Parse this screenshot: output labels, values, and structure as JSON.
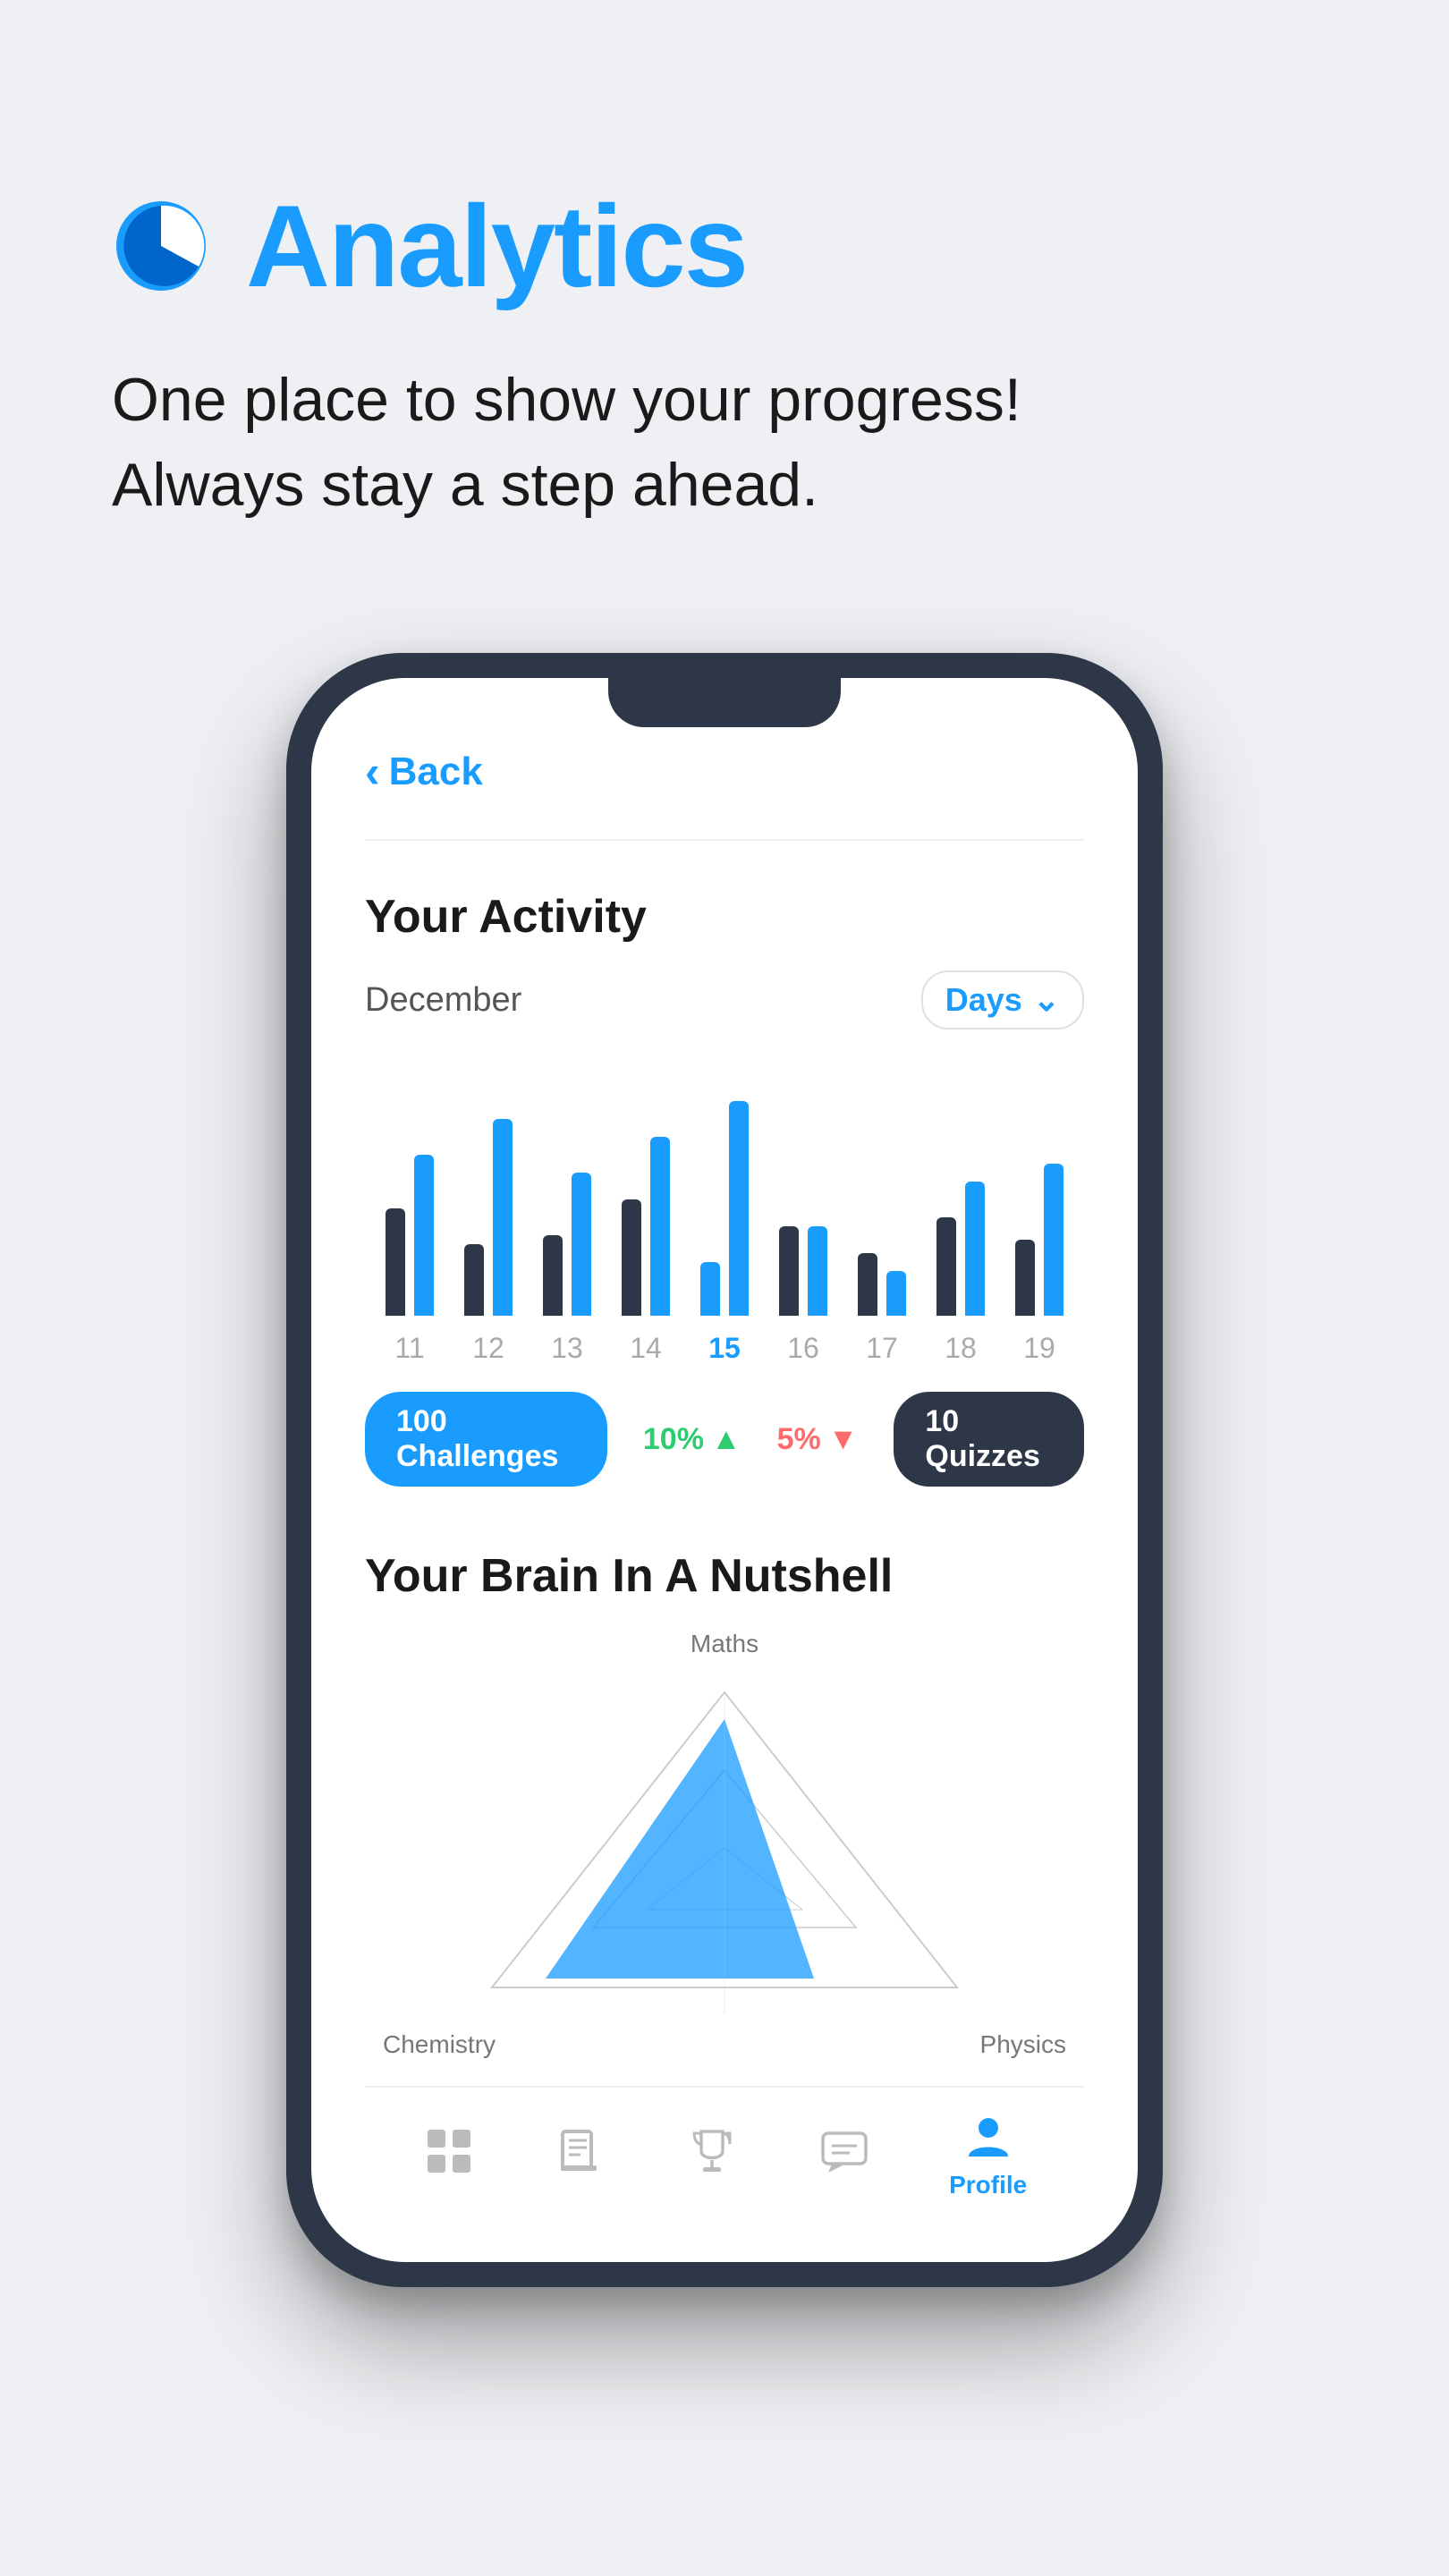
{
  "header": {
    "icon_label": "analytics-pie-icon",
    "title": "Analytics",
    "subtitle_line1": "One place to show your progress!",
    "subtitle_line2": "Always stay a step ahead."
  },
  "phone": {
    "back_label": "Back",
    "activity": {
      "section_title": "Your Activity",
      "month": "December",
      "period_selector": "Days",
      "bars": [
        {
          "day": "11",
          "dark_height": 120,
          "blue_height": 180
        },
        {
          "day": "12",
          "dark_height": 80,
          "blue_height": 220
        },
        {
          "day": "13",
          "dark_height": 90,
          "blue_height": 160
        },
        {
          "day": "14",
          "dark_height": 130,
          "blue_height": 200
        },
        {
          "day": "15",
          "dark_height": 60,
          "blue_height": 240
        },
        {
          "day": "16",
          "dark_height": 100,
          "blue_height": 100
        },
        {
          "day": "17",
          "dark_height": 70,
          "blue_height": 50
        },
        {
          "day": "18",
          "dark_height": 110,
          "blue_height": 150
        },
        {
          "day": "19",
          "dark_height": 85,
          "blue_height": 170
        }
      ],
      "active_day": "15",
      "badge1": "100 Challenges",
      "stat1_value": "10%",
      "stat1_direction": "up",
      "stat2_value": "5%",
      "stat2_direction": "down",
      "badge2": "10 Quizzes"
    },
    "brain": {
      "section_title": "Your Brain In A Nutshell",
      "label_top": "Maths",
      "label_bottom_left": "Chemistry",
      "label_bottom_right": "Physics"
    },
    "nav": [
      {
        "id": "home",
        "label": "",
        "active": false,
        "icon": "grid-icon"
      },
      {
        "id": "books",
        "label": "",
        "active": false,
        "icon": "book-icon"
      },
      {
        "id": "trophy",
        "label": "",
        "active": false,
        "icon": "trophy-icon"
      },
      {
        "id": "chat",
        "label": "",
        "active": false,
        "icon": "chat-icon"
      },
      {
        "id": "profile",
        "label": "Profile",
        "active": true,
        "icon": "person-icon"
      }
    ]
  }
}
